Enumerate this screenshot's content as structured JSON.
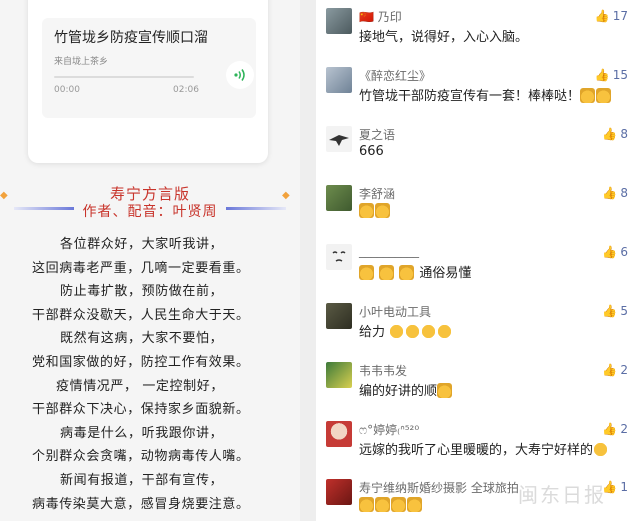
{
  "audio": {
    "title": "竹管垅乡防疫宣传顺口溜",
    "source": "来自垅上茶乡",
    "current_time": "00:00",
    "duration": "02:06",
    "progress": 0
  },
  "header": {
    "version": "寿宁方言版",
    "author": "作者、配音：叶贤周"
  },
  "poem": [
    "各位群众好，大家听我讲，",
    "这回病毒老严重，几嘀一定要看重。",
    "防止毒扩散，预防做在前，",
    "干部群众没歇天，人民生命大于天。",
    "既然有这病，大家不要怕，",
    "党和国家做的好，防控工作有效果。",
    "疫情情况严，  一定控制好，",
    "干部群众下决心，保持家乡面貌新。",
    "病毒是什么，听我跟你讲，",
    "个别群众会贪嘴，动物病毒传人嘴。",
    "新闻有报道，干部有宣传，",
    "病毒传染莫大意，感冒身烧要注意。"
  ],
  "comments": [
    {
      "name": "乃印",
      "name_prefix": "🇨🇳",
      "text": "接地气，说得好，入心入脑。",
      "likes": "17"
    },
    {
      "name": "《醉恋红尘》",
      "text": "竹管垅干部防疫宣传有一套！棒棒哒！",
      "likes": "15"
    },
    {
      "name": "夏之语",
      "text": "666",
      "likes": "8"
    },
    {
      "name": "李舒涵",
      "text": "",
      "likes": "8"
    },
    {
      "name": "__________",
      "text": "通俗易懂",
      "likes": "6"
    },
    {
      "name": "小叶电动工具",
      "text": "给力",
      "likes": "5"
    },
    {
      "name": "韦韦韦发",
      "text": "编的好讲的顺",
      "likes": "2"
    },
    {
      "name": "ෆ°婷婷₍ᐢ⁵²⁰",
      "text": "远嫁的我听了心里暖暖的，大寿宁好样的",
      "likes": "2"
    },
    {
      "name": "寿宁维纳斯婚纱摄影 全球旅拍",
      "text": "",
      "likes": "1"
    }
  ],
  "watermark": "闽东日报",
  "colors": {
    "like": "#5b6ea5",
    "header_red": "#c8342b",
    "play_green": "#2fb45a"
  }
}
